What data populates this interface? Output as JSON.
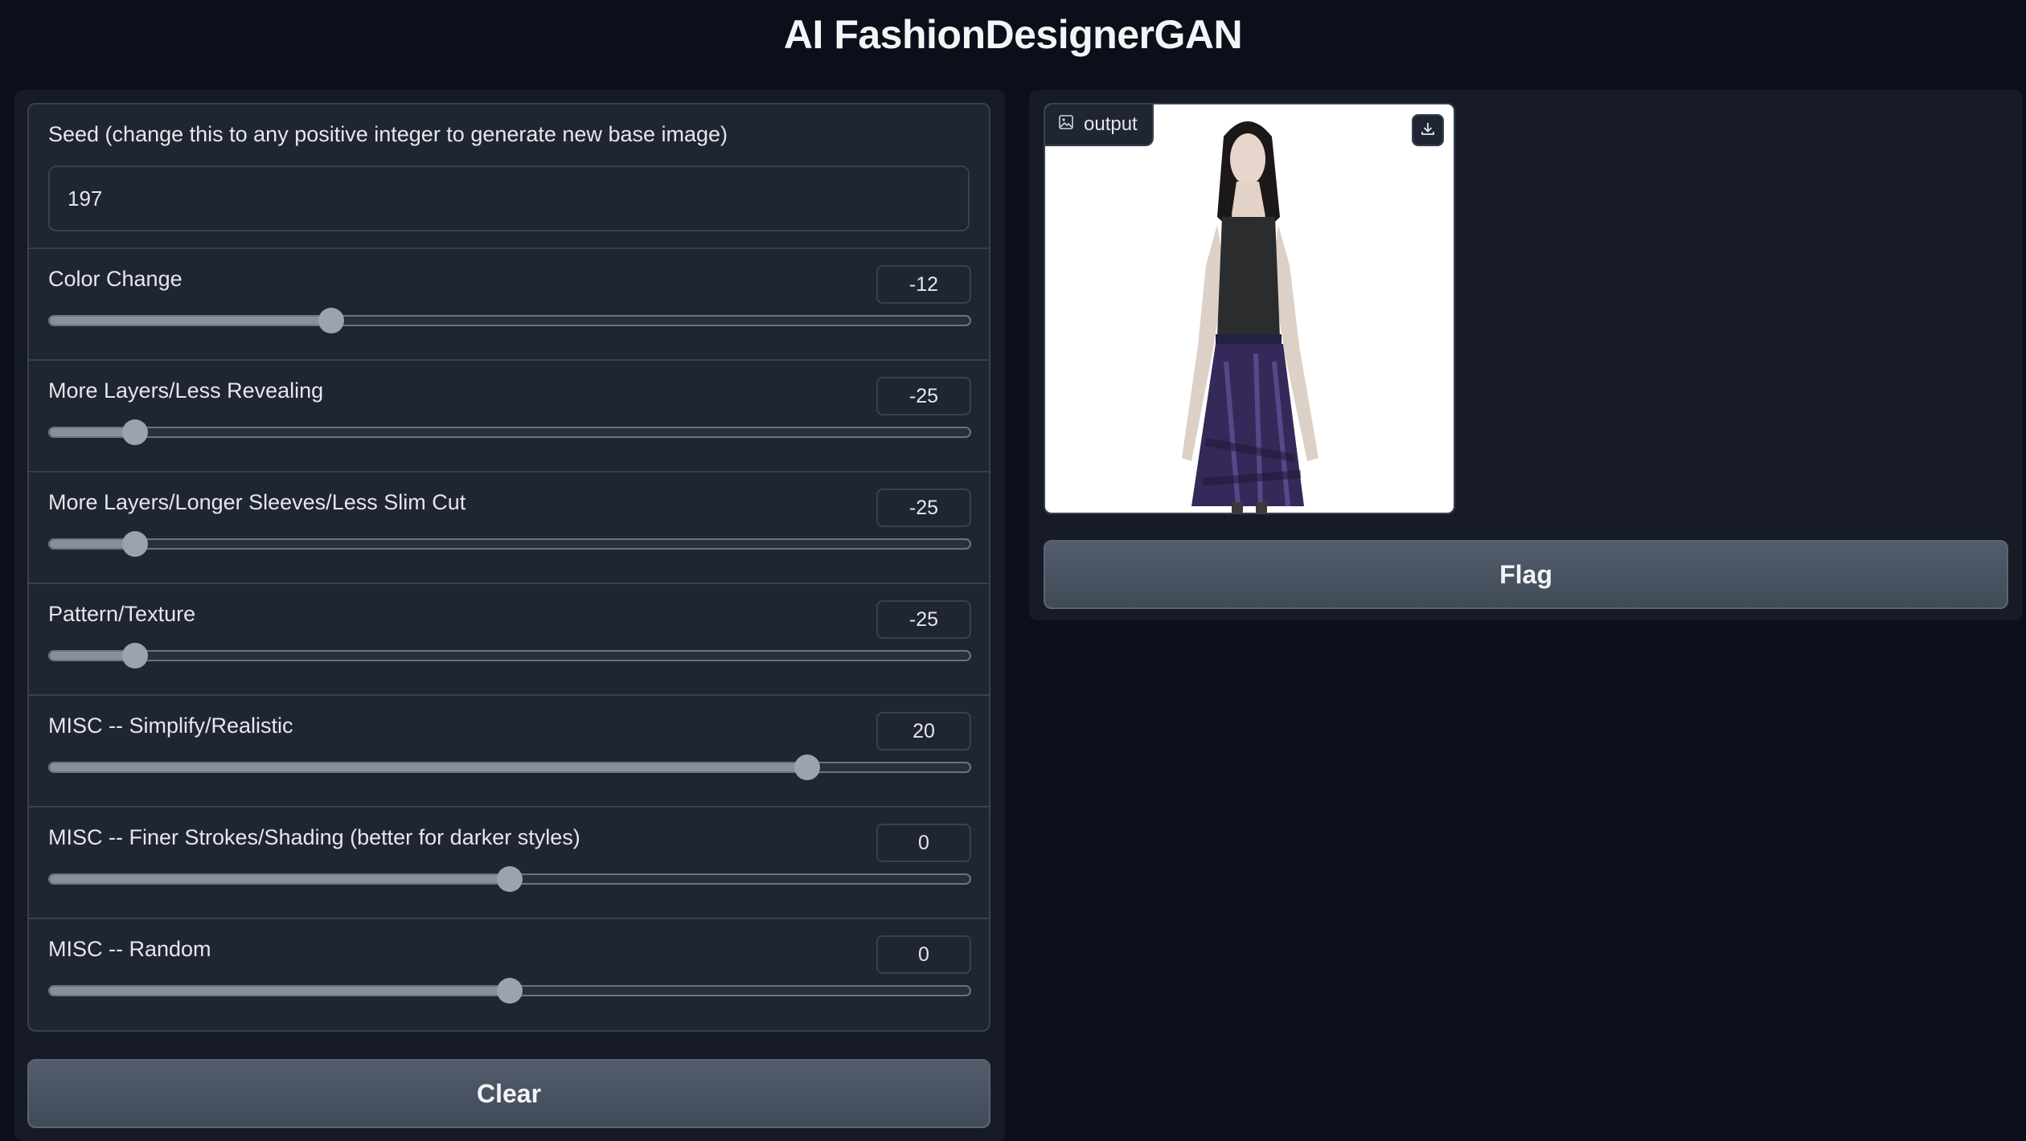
{
  "app": {
    "title": "AI FashionDesignerGAN"
  },
  "inputs": {
    "seed": {
      "label": "Seed (change this to any positive integer to generate new base image)",
      "value": "197"
    },
    "sliders": [
      {
        "label": "Color Change",
        "value": "-12",
        "fraction": 0.306
      },
      {
        "label": "More Layers/Less Revealing",
        "value": "-25",
        "fraction": 0.093
      },
      {
        "label": "More Layers/Longer Sleeves/Less Slim Cut",
        "value": "-25",
        "fraction": 0.093
      },
      {
        "label": "Pattern/Texture",
        "value": "-25",
        "fraction": 0.093
      },
      {
        "label": "MISC -- Simplify/Realistic",
        "value": "20",
        "fraction": 0.823
      },
      {
        "label": "MISC -- Finer Strokes/Shading (better for darker styles)",
        "value": "0",
        "fraction": 0.5
      },
      {
        "label": "MISC -- Random",
        "value": "0",
        "fraction": 0.5
      }
    ]
  },
  "buttons": {
    "clear": "Clear",
    "flag": "Flag"
  },
  "output": {
    "label": "output",
    "icon": "image-icon",
    "download_icon": "download-icon"
  },
  "colors": {
    "background": "#0b0f19",
    "panel": "#161b26",
    "block": "#1f2532",
    "border": "#374151",
    "button": "#4b5563"
  }
}
